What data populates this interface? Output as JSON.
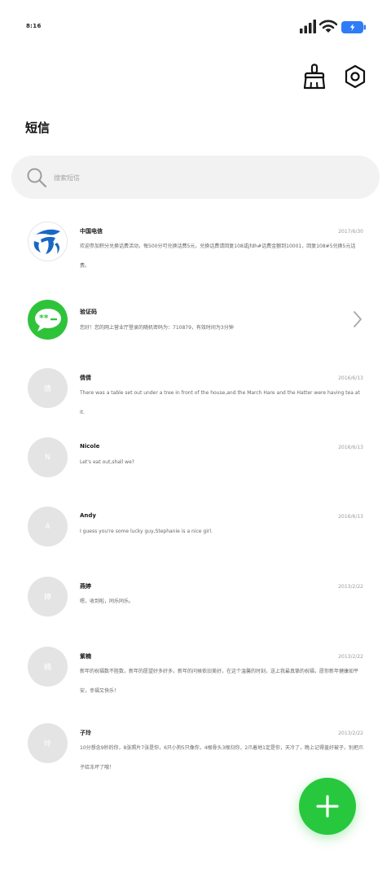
{
  "status_bar": {
    "time": "8:16"
  },
  "header": {
    "title": "短信"
  },
  "search": {
    "placeholder": "搜索短信"
  },
  "messages": [
    {
      "sender": "中国电信",
      "date": "2017/6/30",
      "avatar_type": "china-telecom-logo",
      "preview": "欢迎参加积分兑换话费活动，每500分可兑换话费5元，兑换话费请回复108或jfdh#话费金额到10001，回复108#5兑换5元话费。"
    },
    {
      "sender": "验证码",
      "date": "",
      "avatar_type": "chat-bubble-icon",
      "preview": "您好！您的网上营业厅登录的随机密码为：710879，有效时间为3分钟"
    },
    {
      "sender": "倩倩",
      "date": "2016/6/13",
      "avatar_letter": "倩",
      "preview": "There was a table set out under a tree in front of the house,and the March Hare and the Hatter were having tea at it."
    },
    {
      "sender": "Nicole",
      "date": "2016/6/13",
      "avatar_letter": "N",
      "preview": "Let's eat out,shall we?"
    },
    {
      "sender": "Andy",
      "date": "2016/6/13",
      "avatar_letter": "A",
      "preview": "I guess you're some lucky guy,Stephanie is a nice girl."
    },
    {
      "sender": "燕婷",
      "date": "2013/2/22",
      "avatar_letter": "婷",
      "preview": "嗯，收到啦，同乐同乐。"
    },
    {
      "sender": "紫楠",
      "date": "2013/2/22",
      "avatar_letter": "楠",
      "preview": "新年的祝福数不胜数，新年的愿望好多好多，新年的问候依旧美好，在这个温馨的时刻，送上我最真挚的祝福，愿你新年健康如平安，幸福又快乐！"
    },
    {
      "sender": "子玲",
      "date": "2013/2/22",
      "avatar_letter": "玲",
      "preview": "10分想念9秒的你，8张照片7张是你，6只小狗5只像你，4根骨头3根归你，2爪着地1定是你，天冷了，晚上记得盖好被子，别把爪子给冻坏了哦！"
    }
  ],
  "colors": {
    "accent_green": "#27c83d",
    "battery_blue": "#2f7cf6",
    "telecom_blue": "#1967c4"
  }
}
